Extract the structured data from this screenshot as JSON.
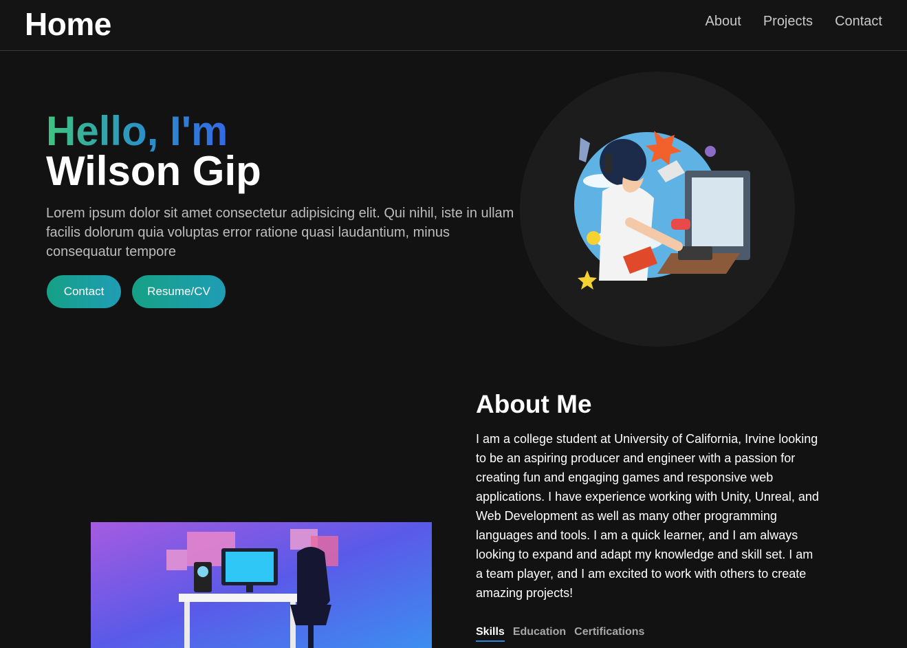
{
  "nav": {
    "brand": "Home",
    "links": [
      "About",
      "Projects",
      "Contact"
    ]
  },
  "hero": {
    "greeting": "Hello, I'm",
    "name": "Wilson Gip",
    "description": "Lorem ipsum dolor sit amet consectetur adipisicing elit. Qui nihil, iste in ullam facilis dolorum quia voluptas error ratione quasi laudantium, minus consequatur tempore",
    "buttons": {
      "contact": "Contact",
      "resume": "Resume/CV"
    }
  },
  "about": {
    "title": "About Me",
    "text": "I am a college student at University of California, Irvine looking to be an aspiring producer and engineer with a passion for creating fun and engaging games and responsive web applications. I have experience working with Unity, Unreal, and Web Development as well as many other programming languages and tools. I am a quick learner, and I am always looking to expand and adapt my knowledge and skill set. I am a team player, and I am excited to work with others to create amazing projects!",
    "tabs": [
      "Skills",
      "Education",
      "Certifications"
    ]
  },
  "colors": {
    "background": "#121212",
    "accent_green": "#3ec47e",
    "accent_blue": "#3469e6",
    "button_gradient": "#16a085"
  }
}
